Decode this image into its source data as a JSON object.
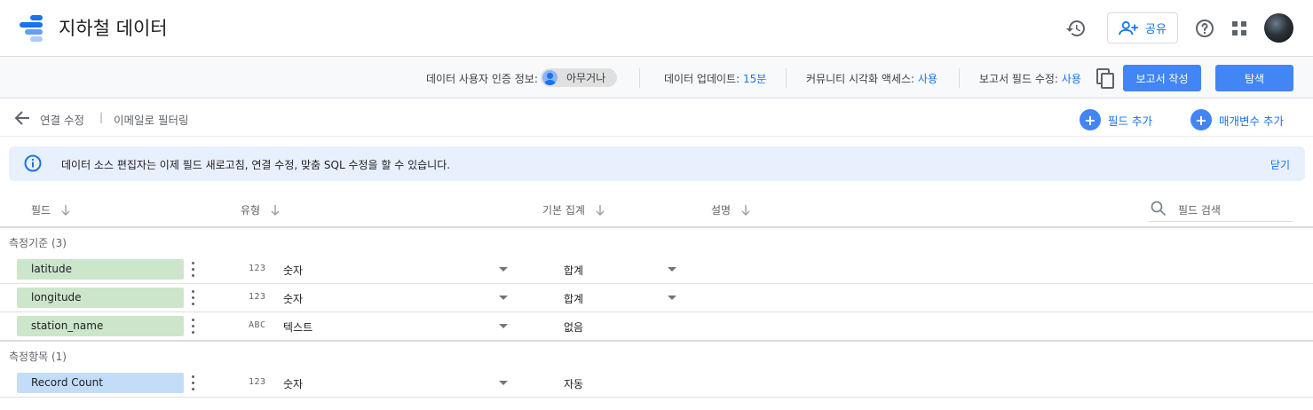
{
  "header": {
    "title": "지하철 데이터",
    "share_label": "공유",
    "logo_colors": [
      "#1a73e8",
      "#669df6",
      "#aecbfa"
    ]
  },
  "infobar": {
    "credentials_label": "데이터 사용자 인증 정보:",
    "credentials_value": "아무거나",
    "freshness_label": "데이터 업데이트:",
    "freshness_value": "15분",
    "community_label": "커뮤니티 시각화 액세스:",
    "community_value": "사용",
    "report_edit_label": "보고서 필드 수정:",
    "report_edit_value": "사용",
    "create_report_label": "보고서 작성",
    "explore_label": "탐색"
  },
  "subbar": {
    "edit_connection": "연결 수정",
    "separator": "|",
    "filter_by_email": "이메일로 필터링",
    "add_field": "필드 추가",
    "add_parameter": "매개변수 추가"
  },
  "notice": {
    "message": "데이터 소스 편집자는 이제 필드 새로고침, 연결 수정, 맞춤 SQL 수정을 할 수 있습니다.",
    "close_label": "닫기"
  },
  "table": {
    "columns": {
      "field": "필드",
      "type": "유형",
      "aggregation": "기본 집계",
      "description": "설명"
    },
    "search_placeholder": "필드 검색",
    "groups": [
      {
        "label": "측정기준 (3)",
        "kind": "dimension",
        "rows": [
          {
            "name": "latitude",
            "type_icon": "123",
            "type": "숫자",
            "aggregation": "합계"
          },
          {
            "name": "longitude",
            "type_icon": "123",
            "type": "숫자",
            "aggregation": "합계"
          },
          {
            "name": "station_name",
            "type_icon": "ABC",
            "type": "텍스트",
            "aggregation": "없음"
          }
        ]
      },
      {
        "label": "측정항목 (1)",
        "kind": "metric",
        "rows": [
          {
            "name": "Record Count",
            "type_icon": "123",
            "type": "숫자",
            "aggregation": "자동"
          }
        ]
      }
    ]
  },
  "colors": {
    "accent": "#4285f4",
    "link": "#1a73e8",
    "dimension_chip": "#cce6cb",
    "metric_chip": "#c3ddf9",
    "notice_bg": "#e8f0fe"
  }
}
